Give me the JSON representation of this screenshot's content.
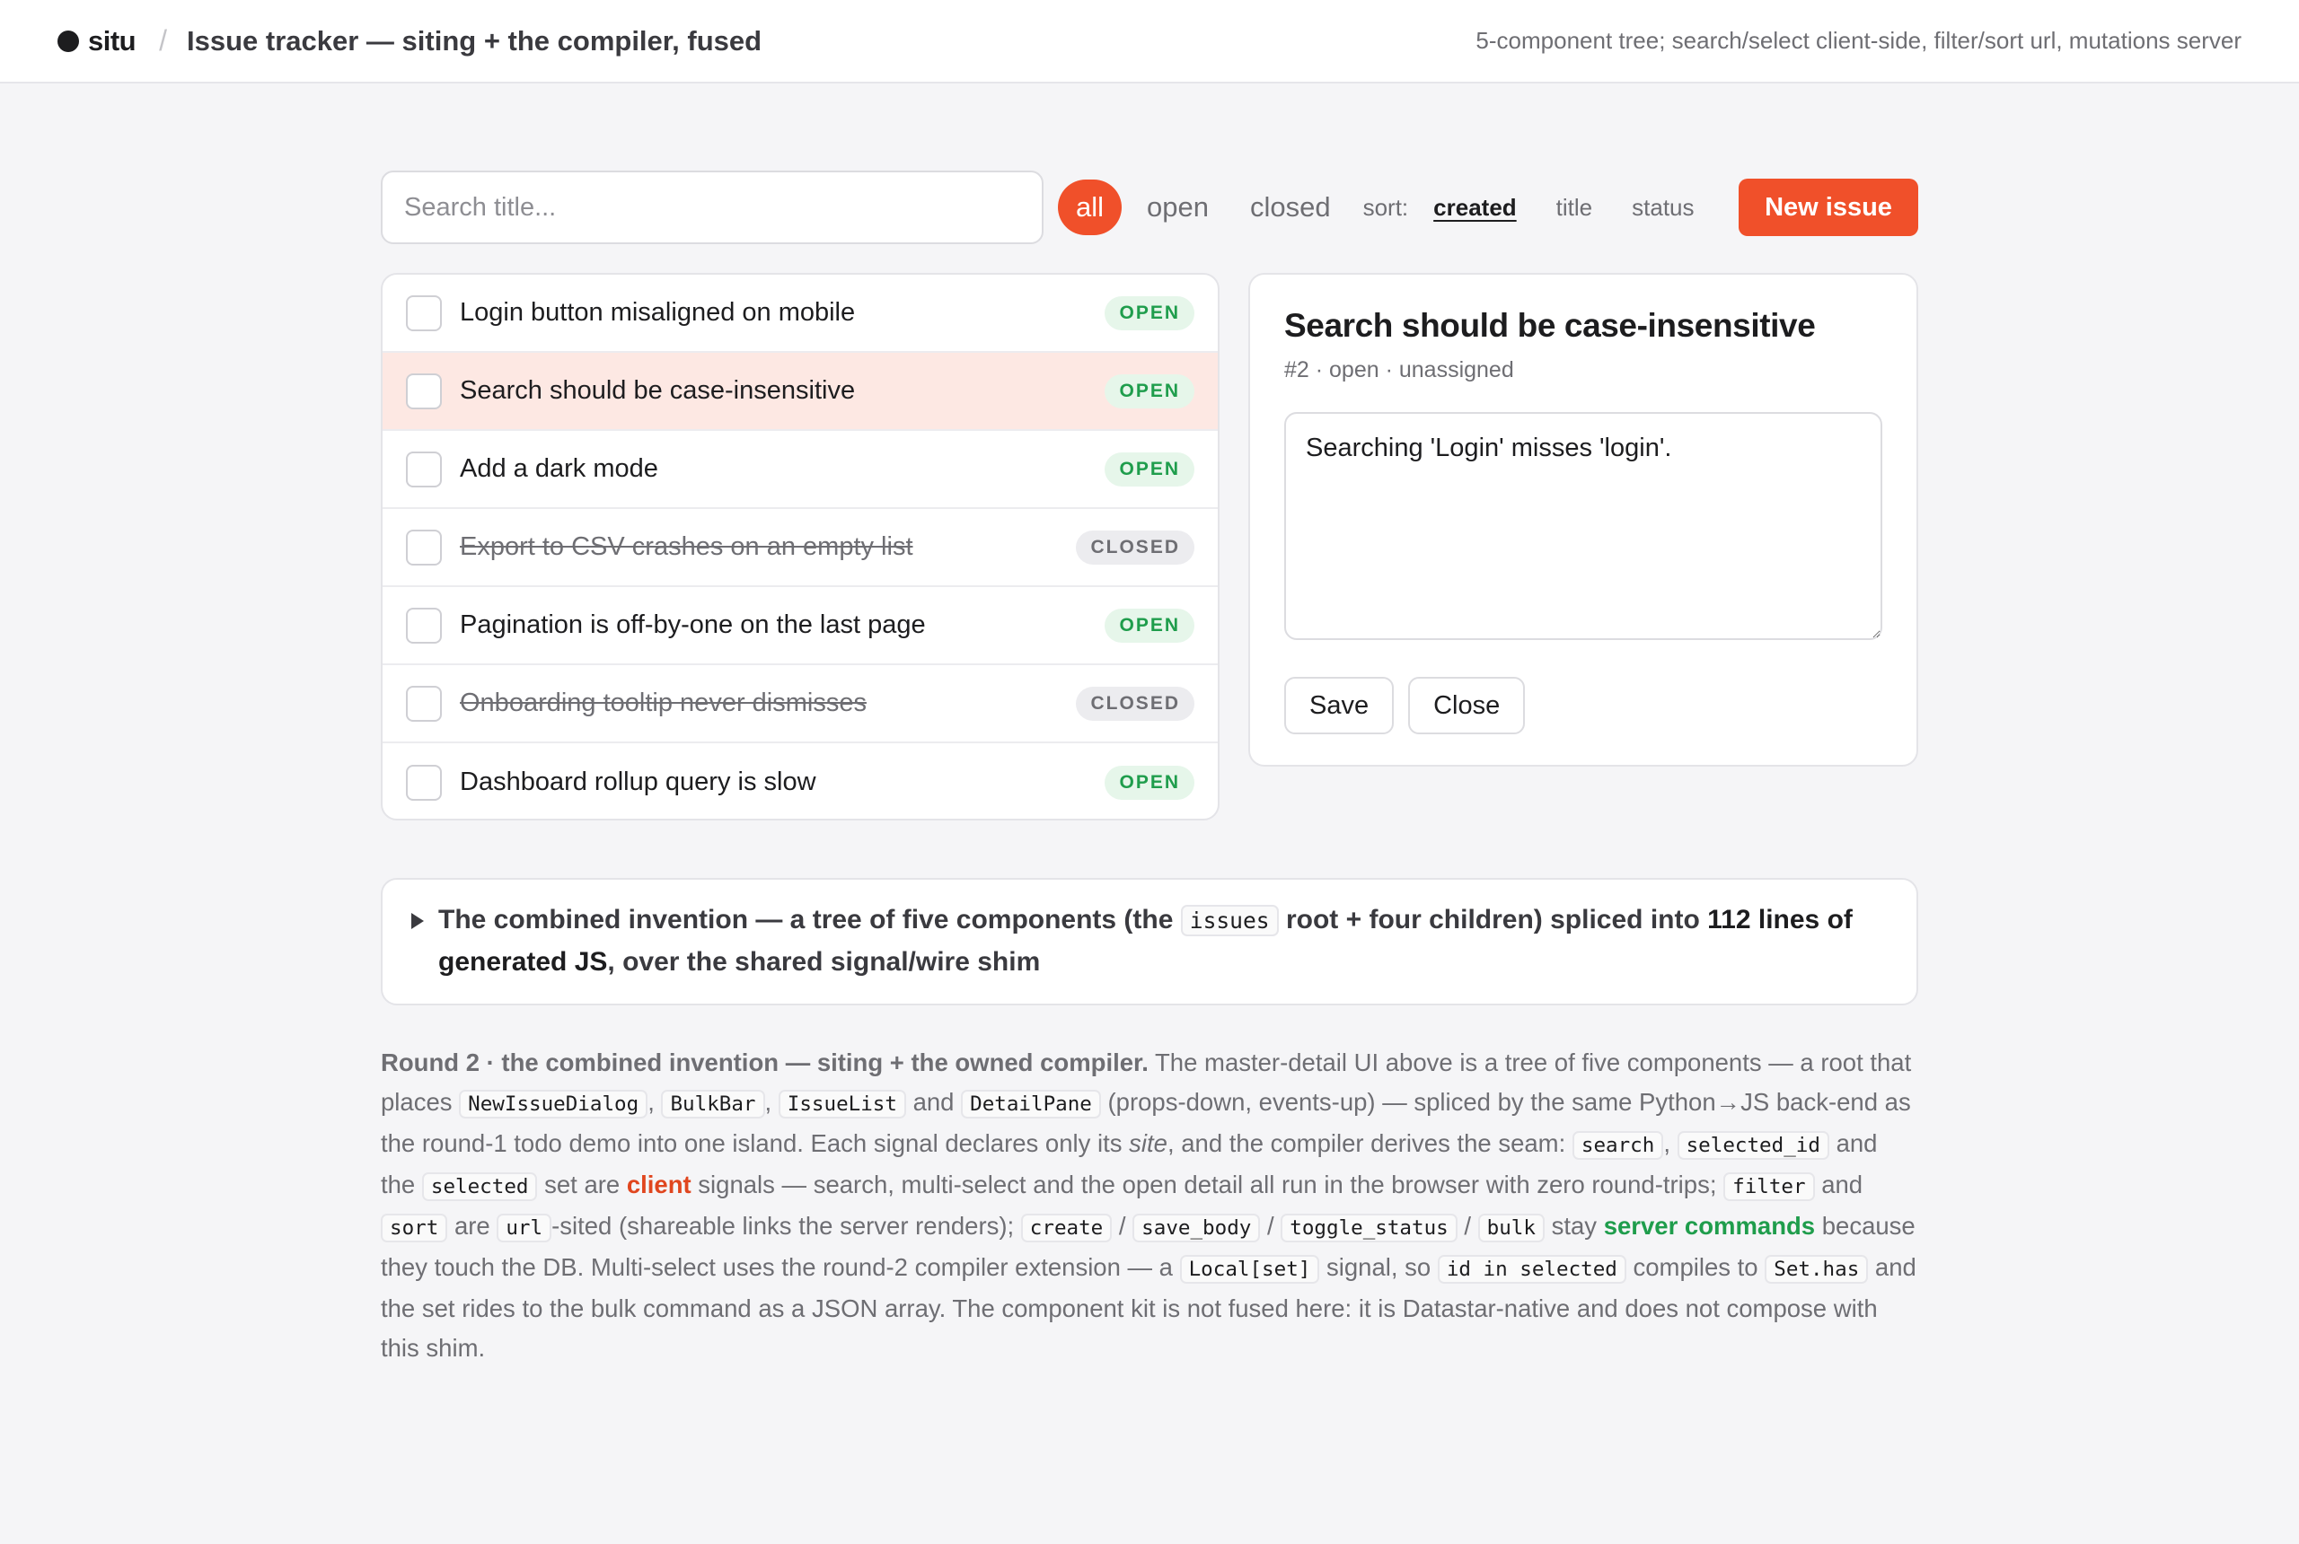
{
  "header": {
    "brand": "situ",
    "separator": "/",
    "title": "Issue tracker — siting + the compiler, fused",
    "note": "5-component tree; search/select client-side, filter/sort url, mutations server"
  },
  "toolbar": {
    "search_placeholder": "Search title...",
    "filters": [
      "all",
      "open",
      "closed"
    ],
    "active_filter": "all",
    "sort_label": "sort:",
    "sort_options": [
      "created",
      "title",
      "status"
    ],
    "active_sort": "created",
    "new_issue_label": "New issue"
  },
  "issues": [
    {
      "title": "Login button misaligned on mobile",
      "status": "OPEN"
    },
    {
      "title": "Search should be case-insensitive",
      "status": "OPEN",
      "selected": true
    },
    {
      "title": "Add a dark mode",
      "status": "OPEN"
    },
    {
      "title": "Export to CSV crashes on an empty list",
      "status": "CLOSED"
    },
    {
      "title": "Pagination is off-by-one on the last page",
      "status": "OPEN"
    },
    {
      "title": "Onboarding tooltip never dismisses",
      "status": "CLOSED"
    },
    {
      "title": "Dashboard rollup query is slow",
      "status": "OPEN"
    }
  ],
  "detail": {
    "title": "Search should be case-insensitive",
    "meta": "#2 · open · unassigned",
    "body": "Searching 'Login' misses 'login'.",
    "save_label": "Save",
    "close_label": "Close"
  },
  "summary": {
    "text_1": "The combined invention — a tree of five components (the ",
    "code_1": "issues",
    "text_2": " root + four children) spliced into ",
    "bold_1": "112 lines of generated JS",
    "text_3": ", over the shared signal/wire shim"
  },
  "prose": {
    "lead": "Round 2 · the combined invention — siting + the owned compiler.",
    "t1": " The master-detail UI above is a tree of five components — a root that places ",
    "c1": "NewIssueDialog",
    "t2": ", ",
    "c2": "BulkBar",
    "t3": ", ",
    "c3": "IssueList",
    "t4": " and ",
    "c4": "DetailPane",
    "t5": " (props-down, events-up) — spliced by the same Python→JS back-end as the round-1 todo demo into one island. Each signal declares only its ",
    "em1": "site",
    "t6": ", and the compiler derives the seam: ",
    "c5": "search",
    "t7": ", ",
    "c6": "selected_id",
    "t8": " and the ",
    "c7": "selected",
    "t9": " set are ",
    "client": "client",
    "t10": " signals — search, multi-select and the open detail all run in the browser with zero round-trips; ",
    "c8": "filter",
    "t11": " and ",
    "c9": "sort",
    "t12": " are ",
    "c10": "url",
    "t13": "-sited (shareable links the server renders); ",
    "c11": "create",
    "t14": " / ",
    "c12": "save_body",
    "t15": " / ",
    "c13": "toggle_status",
    "t16": " / ",
    "c14": "bulk",
    "t17": " stay ",
    "server": "server commands",
    "t18": " because they touch the DB. Multi-select uses the round-2 compiler extension — a ",
    "c15": "Local[set]",
    "t19": " signal, so ",
    "c16": "id in selected",
    "t20": " compiles to ",
    "c17": "Set.has",
    "t21": " and the set rides to the bulk command as a JSON array. The component kit is not fused here: it is Datastar-native and does not compose with this shim."
  },
  "colors": {
    "accent": "#f0502a",
    "open_badge": "#1f9d4c",
    "client": "#e0461f",
    "server": "#1f9d4c",
    "selected_row": "#fde8e3"
  }
}
